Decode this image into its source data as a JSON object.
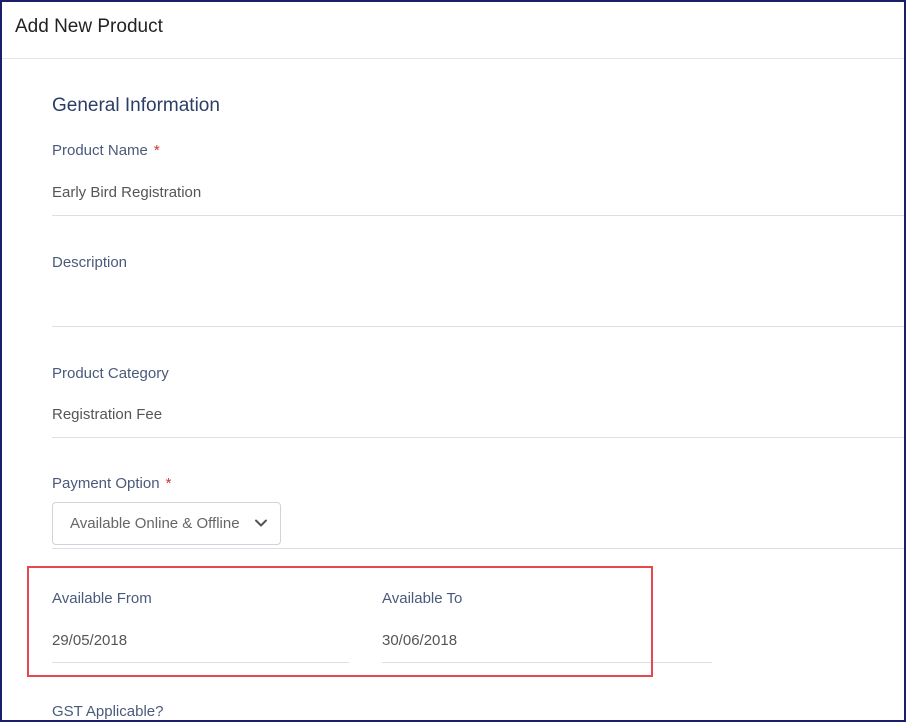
{
  "header": {
    "title": "Add New Product"
  },
  "section": {
    "title": "General Information"
  },
  "fields": {
    "product_name": {
      "label": "Product Name",
      "required": "*",
      "value": "Early Bird Registration"
    },
    "description": {
      "label": "Description",
      "value": ""
    },
    "product_category": {
      "label": "Product Category",
      "value": "Registration Fee"
    },
    "payment_option": {
      "label": "Payment Option",
      "required": "*",
      "selected": "Available Online & Offline"
    },
    "available_from": {
      "label": "Available From",
      "value": "29/05/2018"
    },
    "available_to": {
      "label": "Available To",
      "value": "30/06/2018"
    },
    "gst_applicable": {
      "label": "GST Applicable?"
    }
  },
  "icons": {
    "dropdown": "chevron-down-icon"
  },
  "colors": {
    "highlight": "#e5484d",
    "frame": "#1b1f6b",
    "required": "#d0342c"
  }
}
